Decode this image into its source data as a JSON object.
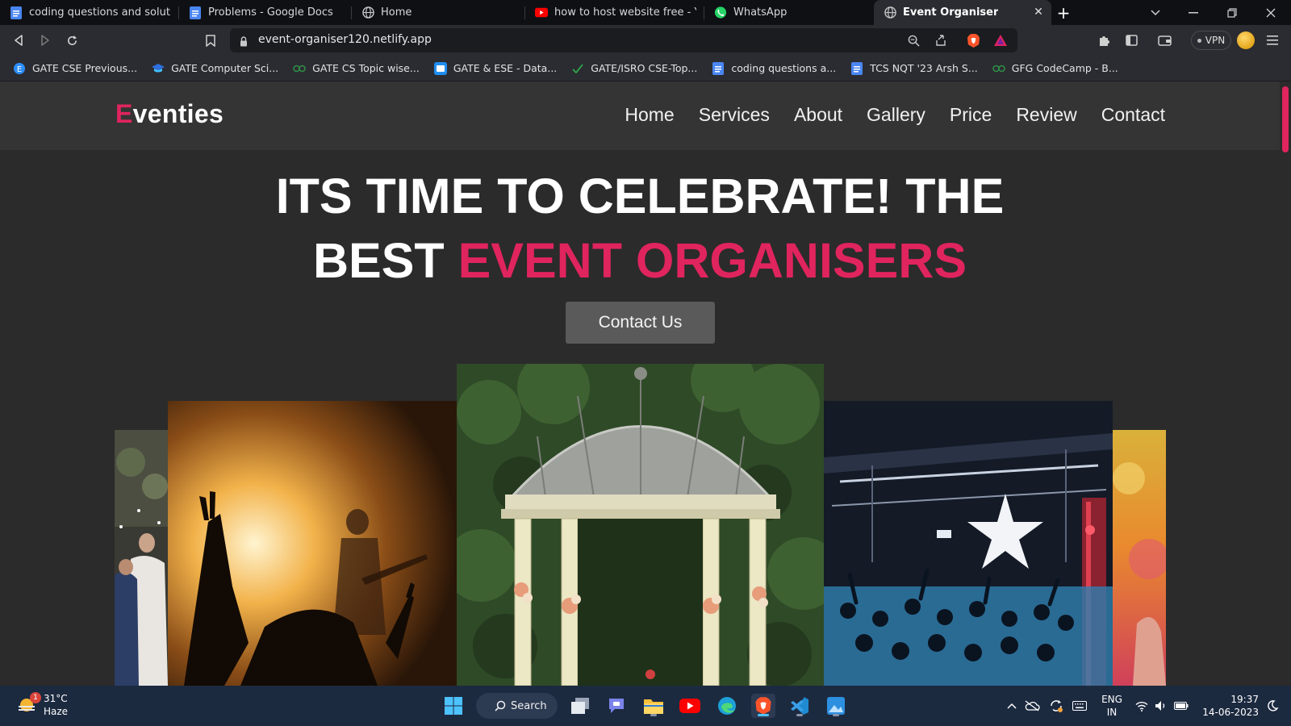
{
  "browser": {
    "tabs": [
      {
        "title": "coding questions and solution - ",
        "icon": "google-docs-icon"
      },
      {
        "title": "Problems - Google Docs",
        "icon": "google-docs-icon"
      },
      {
        "title": "Home",
        "icon": "globe-icon"
      },
      {
        "title": "how to host website free - YouTu",
        "icon": "youtube-icon"
      },
      {
        "title": "WhatsApp",
        "icon": "whatsapp-icon"
      },
      {
        "title": "Event Organiser",
        "icon": "globe-icon",
        "active": true
      }
    ],
    "url": "event-organiser120.netlify.app",
    "vpn_label": "VPN",
    "bookmarks": [
      {
        "label": "GATE CSE Previous...",
        "icon": "e-icon"
      },
      {
        "label": "GATE Computer Sci...",
        "icon": "cap-icon"
      },
      {
        "label": "GATE CS Topic wise...",
        "icon": "gfg-icon"
      },
      {
        "label": "GATE & ESE - Data...",
        "icon": "doc-icon"
      },
      {
        "label": "GATE/ISRO CSE-Top...",
        "icon": "check-icon"
      },
      {
        "label": "coding questions a...",
        "icon": "google-docs-icon"
      },
      {
        "label": "TCS NQT '23 Arsh S...",
        "icon": "google-docs-icon"
      },
      {
        "label": "GFG CodeCamp - B...",
        "icon": "gfg-icon"
      }
    ]
  },
  "site": {
    "logo_first": "E",
    "logo_rest": "venties",
    "nav": [
      "Home",
      "Services",
      "About",
      "Gallery",
      "Price",
      "Review",
      "Contact"
    ],
    "hero_line1": "ITS TIME TO CELEBRATE! THE",
    "hero_line2_plain": "BEST ",
    "hero_line2_accent": "EVENT ORGANISERS",
    "cta_label": "Contact Us",
    "accent_color": "#e0245e",
    "gallery": [
      "wedding-guests-photo",
      "concert-crowd-photo",
      "garden-gazebo-photo",
      "club-party-photo",
      "holi-colors-photo"
    ]
  },
  "taskbar": {
    "weather_temp": "31°C",
    "weather_desc": "Haze",
    "weather_badge": "1",
    "search_label": "Search",
    "lang_line1": "ENG",
    "lang_line2": "IN",
    "time": "19:37",
    "date": "14-06-2023"
  }
}
